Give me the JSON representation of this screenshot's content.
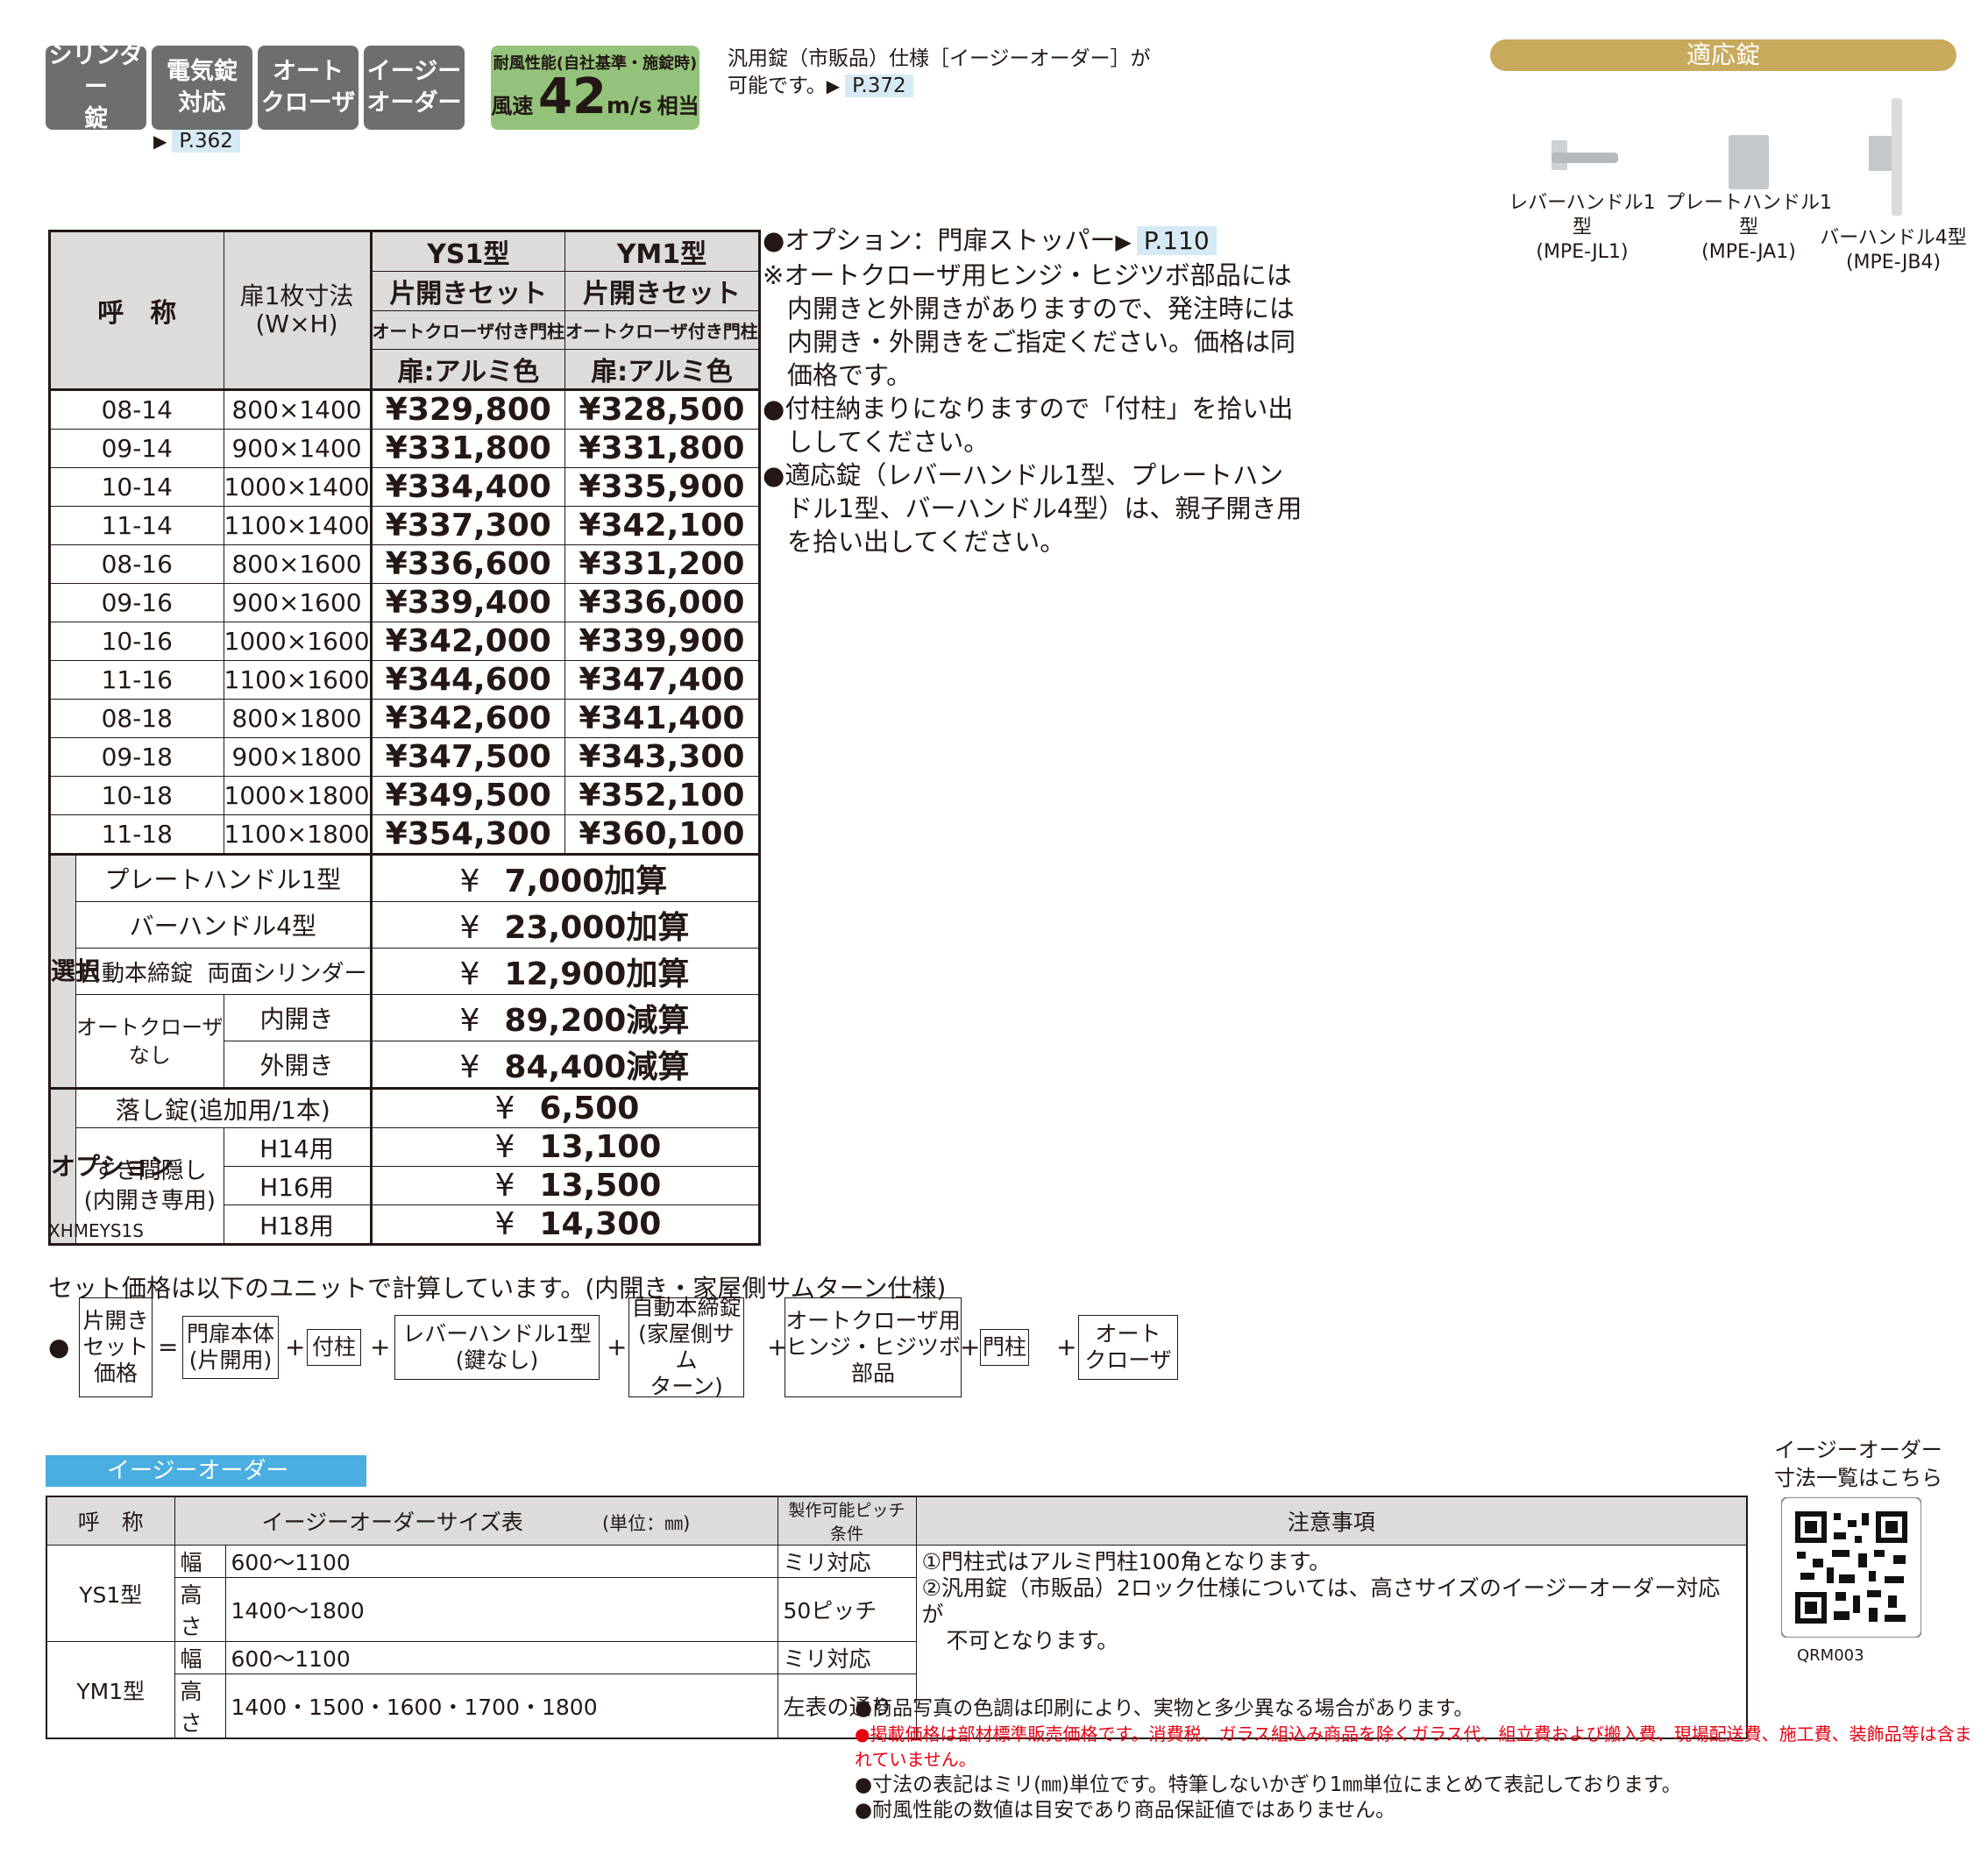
{
  "badges": [
    {
      "line1": "シリンダー",
      "line2": "錠"
    },
    {
      "line1": "電気錠",
      "line2": "対応"
    },
    {
      "line1": "オート",
      "line2": "クローザ"
    },
    {
      "line1": "イージー",
      "line2": "オーダー"
    }
  ],
  "badge_ref": "P.362",
  "wind": {
    "line1": "耐風性能(自社基準・施錠時)",
    "prefix": "風速",
    "value": "42",
    "unit": "m/s",
    "suffix": "相当"
  },
  "easy_note": {
    "line1": "汎用錠（市販品）仕様［イージーオーダー］が",
    "line2": "可能です。",
    "ref": "P.372"
  },
  "lock": {
    "header": "適応錠",
    "items": [
      {
        "name": "レバーハンドル1型",
        "code": "(MPE-JL1)"
      },
      {
        "name": "プレートハンドル1型",
        "code": "(MPE-JA1)"
      },
      {
        "name": "バーハンドル4型",
        "code": "(MPE-JB4)"
      }
    ]
  },
  "table": {
    "col_name": "呼　称",
    "col_size": "扉1枚寸法",
    "col_size2": "(W×H)",
    "models": [
      {
        "name": "YS1型",
        "set": "片開きセット",
        "sub": "オートクローザ付き門柱",
        "color": "扉:アルミ色"
      },
      {
        "name": "YM1型",
        "set": "片開きセット",
        "sub": "オートクローザ付き門柱",
        "color": "扉:アルミ色"
      }
    ],
    "rows": [
      {
        "code": "08-14",
        "size": "800×1400",
        "ys": "¥329,800",
        "ym": "¥328,500"
      },
      {
        "code": "09-14",
        "size": "900×1400",
        "ys": "¥331,800",
        "ym": "¥331,800"
      },
      {
        "code": "10-14",
        "size": "1000×1400",
        "ys": "¥334,400",
        "ym": "¥335,900"
      },
      {
        "code": "11-14",
        "size": "1100×1400",
        "ys": "¥337,300",
        "ym": "¥342,100"
      },
      {
        "code": "08-16",
        "size": "800×1600",
        "ys": "¥336,600",
        "ym": "¥331,200"
      },
      {
        "code": "09-16",
        "size": "900×1600",
        "ys": "¥339,400",
        "ym": "¥336,000"
      },
      {
        "code": "10-16",
        "size": "1000×1600",
        "ys": "¥342,000",
        "ym": "¥339,900"
      },
      {
        "code": "11-16",
        "size": "1100×1600",
        "ys": "¥344,600",
        "ym": "¥347,400"
      },
      {
        "code": "08-18",
        "size": "800×1800",
        "ys": "¥342,600",
        "ym": "¥341,400"
      },
      {
        "code": "09-18",
        "size": "900×1800",
        "ys": "¥347,500",
        "ym": "¥343,300"
      },
      {
        "code": "10-18",
        "size": "1000×1800",
        "ys": "¥349,500",
        "ym": "¥352,100"
      },
      {
        "code": "11-18",
        "size": "1100×1800",
        "ys": "¥354,300",
        "ym": "¥360,100"
      }
    ],
    "select_label": "選択",
    "select": {
      "plate": "プレートハンドル1型",
      "plate_price": "7,000加算",
      "bar": "バーハンドル4型",
      "bar_price": "23,000加算",
      "auto_lock": "自動本締錠",
      "auto_lock_sub": "両面シリンダー",
      "auto_lock_price": "12,900加算",
      "no_closer1": "オートクローザ",
      "no_closer2": "なし",
      "inside": "内開き",
      "inside_price": "89,200減算",
      "outside": "外開き",
      "outside_price": "84,400減算"
    },
    "option_label": "オプション",
    "option": {
      "drop": "落し錠(追加用/1本)",
      "drop_price": "6,500",
      "gap1": "すき間隠し",
      "gap2": "(内開き専用)",
      "h14": "H14用",
      "h14_price": "13,100",
      "h16": "H16用",
      "h16_price": "13,500",
      "h18": "H18用",
      "h18_price": "14,300"
    },
    "yen": "¥",
    "code": "XHMEYS1S"
  },
  "notes": [
    {
      "mark": "●",
      "text": "オプション：門扉ストッパー",
      "ref": "P.110"
    },
    {
      "mark": "※",
      "text": "オートクローザ用ヒンジ・ヒジツボ部品には内開きと外開きがありますので、発注時には内開き・外開きをご指定ください。価格は同価格です。"
    },
    {
      "mark": "●",
      "text": "付柱納まりになりますので「付柱」を拾い出ししてください。"
    },
    {
      "mark": "●",
      "text": "適応錠（レバーハンドル1型、プレートハンドル1型、バーハンドル4型）は、親子開き用を拾い出してください。"
    }
  ],
  "set_calc": {
    "title": "セット価格は以下のユニットで計算しています。(内開き・家屋側サムターン仕様)",
    "bullet": "●",
    "result": [
      "片開き",
      "セット",
      "価格"
    ],
    "eq": "=",
    "plus": "+",
    "units": [
      [
        "門扉本体",
        "(片開用)"
      ],
      [
        "付柱"
      ],
      [
        "レバーハンドル1型",
        "(鍵なし)"
      ],
      [
        "自動本締錠",
        "(家屋側サム",
        "ターン)"
      ],
      [
        "オートクローザ用",
        "ヒンジ・ヒジツボ",
        "部品"
      ],
      [
        "門柱"
      ],
      [
        "オート",
        "クローザ"
      ]
    ]
  },
  "easy": {
    "title": "イージーオーダー",
    "h_name": "呼　称",
    "h_size": "イージーオーダーサイズ表",
    "h_unit": "(単位：㎜)",
    "h_pitch": "製作可能ピッチ条件",
    "h_note": "注意事項",
    "rows": [
      {
        "model": "YS1型",
        "dim1": "幅",
        "val1": "600～1100",
        "pitch1": "ミリ対応",
        "dim2": "高さ",
        "val2": "1400～1800",
        "pitch2": "50ピッチ"
      },
      {
        "model": "YM1型",
        "dim1": "幅",
        "val1": "600～1100",
        "pitch1": "ミリ対応",
        "dim2": "高さ",
        "val2": "1400・1500・1600・1700・1800",
        "pitch2": "左表の通り"
      }
    ],
    "note1": "①門柱式はアルミ門柱100角となります。",
    "note2": "②汎用錠（市販品）2ロック仕様については、高さサイズのイージーオーダー対応が",
    "note2b": "不可となります。",
    "qr_caption1": "イージーオーダー",
    "qr_caption2": "寸法一覧はこちら",
    "qr_code": "QRM003"
  },
  "footer": [
    {
      "text": "●商品写真の色調は印刷により、実物と多少異なる場合があります。",
      "color": "#231815"
    },
    {
      "text": "●掲載価格は部材標準販売価格です。消費税、ガラス組込み商品を除くガラス代、組立費および搬入費、現場配送費、施工費、装飾品等は含まれていません。",
      "color": "#e60012"
    },
    {
      "text": "●寸法の表記はミリ(㎜)単位です。特筆しないかぎり1㎜単位にまとめて表記しております。",
      "color": "#231815"
    },
    {
      "text": "●耐風性能の数値は目安であり商品保証値ではありません。",
      "color": "#231815"
    }
  ]
}
